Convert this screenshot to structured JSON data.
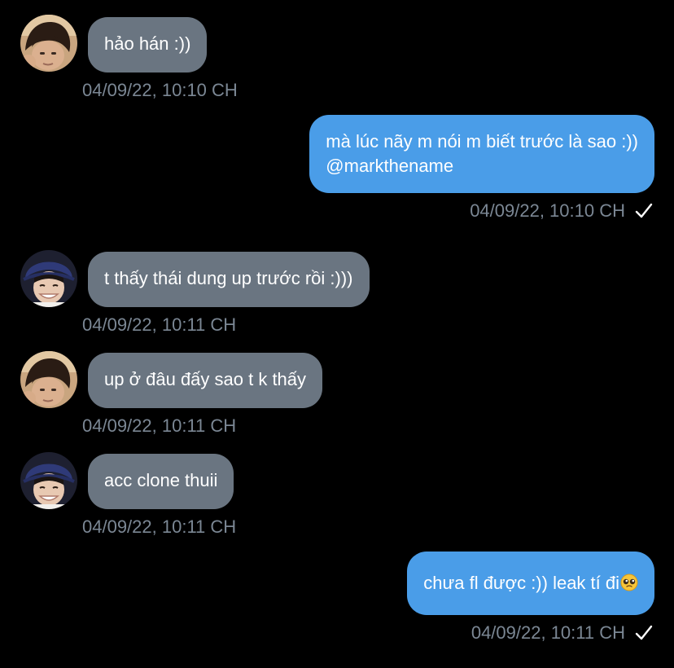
{
  "conversation": {
    "messages": [
      {
        "direction": "incoming",
        "avatar": "avatar-1",
        "text": "hảo hán :))",
        "timestamp": "04/09/22, 10:10 CH"
      },
      {
        "direction": "outgoing",
        "lines": [
          "mà lúc nãy m nói m biết trước là sao :))",
          "@markthename"
        ],
        "timestamp": "04/09/22, 10:10 CH",
        "status_icon": "checkmark-icon"
      },
      {
        "direction": "incoming",
        "avatar": "avatar-2",
        "text": "t thấy thái dung up trước rồi :)))",
        "timestamp": "04/09/22, 10:11 CH"
      },
      {
        "direction": "incoming",
        "avatar": "avatar-1",
        "text": "up ở đâu đấy sao t k thấy",
        "timestamp": "04/09/22, 10:11 CH"
      },
      {
        "direction": "incoming",
        "avatar": "avatar-2",
        "text": "acc clone thuii",
        "timestamp": "04/09/22, 10:11 CH"
      },
      {
        "direction": "outgoing",
        "text": "chưa fl được :)) leak tí đi",
        "emoji": "pleading-face-emoji",
        "timestamp": "04/09/22, 10:11 CH",
        "status_icon": "checkmark-icon"
      }
    ]
  },
  "colors": {
    "background": "#000000",
    "incoming_bubble": "#6a7581",
    "outgoing_bubble": "#4a9de8",
    "timestamp": "#7b8794",
    "text": "#ffffff"
  }
}
